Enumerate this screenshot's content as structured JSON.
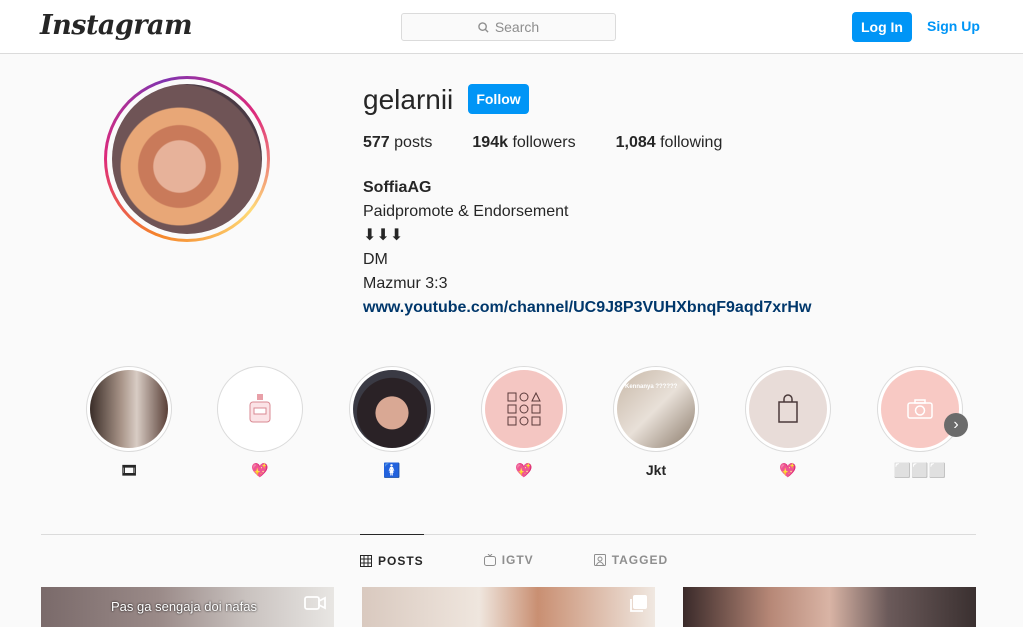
{
  "header": {
    "logo": "Instagram",
    "search_placeholder": "Search",
    "login_label": "Log In",
    "signup_label": "Sign Up"
  },
  "profile": {
    "username": "gelarnii",
    "follow_label": "Follow",
    "stats": {
      "posts_count": "577",
      "posts_label": "posts",
      "followers_count": "194k",
      "followers_label": "followers",
      "following_count": "1,084",
      "following_label": "following"
    },
    "bio": {
      "name": "SoffiaAG",
      "line1": "Paidpromote & Endorsement",
      "line2": "⬇⬇⬇",
      "line3": "DM",
      "line4": "Mazmur 3:3",
      "link": "www.youtube.com/channel/UC9J8P3VUHXbnqF9aqd7xrHw"
    }
  },
  "highlights": [
    {
      "label": "🎞"
    },
    {
      "label": "💖"
    },
    {
      "label": "🚺"
    },
    {
      "label": "💖"
    },
    {
      "label": "Jkt"
    },
    {
      "label": "💖"
    },
    {
      "label": "⬜⬜⬜"
    }
  ],
  "tabs": [
    {
      "label": "POSTS",
      "active": true
    },
    {
      "label": "IGTV",
      "active": false
    },
    {
      "label": "TAGGED",
      "active": false
    }
  ],
  "posts": [
    {
      "caption": "Pas ga sengaja doi nafas",
      "icon": "video-icon"
    },
    {
      "caption": "",
      "icon": "multi-photo-icon"
    },
    {
      "caption": "",
      "icon": ""
    }
  ],
  "highlight_overlay_text": "Kennanya ??????",
  "colors": {
    "accent": "#0095f6",
    "link": "#00376b",
    "text": "#262626",
    "muted": "#8e8e8e",
    "border": "#dbdbdb"
  }
}
